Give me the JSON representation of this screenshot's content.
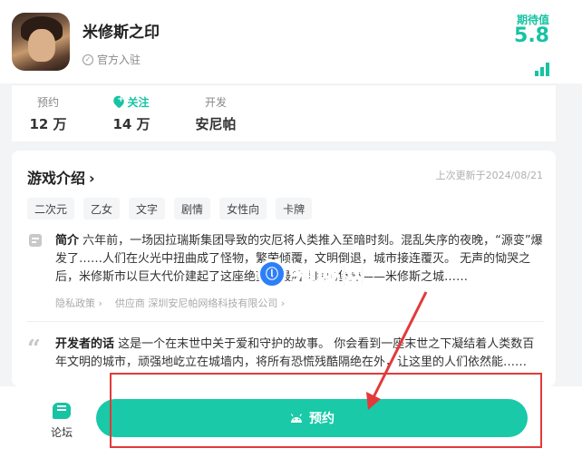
{
  "header": {
    "game_title": "米修斯之印",
    "official_label": "官方入驻",
    "rating_label": "期待值",
    "rating_score": "5.8",
    "icons": {
      "verified": "check-circle-icon",
      "rank": "rank-bars-icon"
    }
  },
  "stats": [
    {
      "label": "预约",
      "value": "12 万"
    },
    {
      "label": "关注",
      "value": "14 万",
      "icon": "heart-plus-icon"
    },
    {
      "label": "开发",
      "value": "安尼帕"
    }
  ],
  "intro": {
    "title": "游戏介绍",
    "chevron": "›",
    "update_time": "上次更新于2024/08/21",
    "tags": [
      "二次元",
      "乙女",
      "文字",
      "剧情",
      "女性向",
      "卡牌"
    ],
    "summary_label": "简介",
    "summary_text": "六年前，一场因拉瑞斯集团导致的灾厄将人类推入至暗时刻。混乱失序的夜晚，“源变”爆发了……人们在火光中扭曲成了怪物，繁荣倾覆，文明倒退，城市接连覆灭。 无声的恸哭之后，米修斯市以巨大代价建起了这座绝望中最后坚固的堡垒——米修斯之城……",
    "privacy_label": "隐私政策 ›",
    "supplier_label": "供应商 深圳安尼帕网络科技有限公司 ›",
    "developer_label": "开发者的话",
    "developer_text": "这是一个在末世中关于爱和守护的故事。 你会看到一座末世之下凝结着人类数百年文明的城市，顽强地屹立在城墙内，将所有恐慌残酷隔绝在外，让这里的人们依然能……"
  },
  "watermark": {
    "text": "领域网"
  },
  "bottom_bar": {
    "forum_label": "论坛",
    "reserve_label": "预约"
  },
  "colors": {
    "accent": "#19c9a7",
    "annotation": "#e23a3a",
    "watermark": "#2d7ff9"
  }
}
